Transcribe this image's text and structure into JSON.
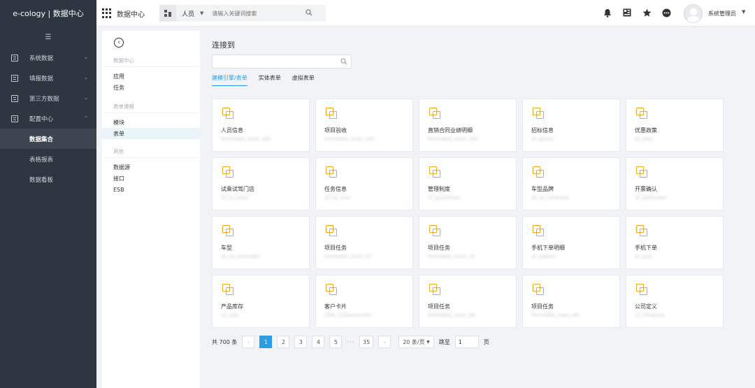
{
  "header": {
    "brand": "e-cology | 数据中心",
    "app_title": "数据中心",
    "search_scope": "人员",
    "search_placeholder": "请输入关键词搜索",
    "user_name": "系统管理员"
  },
  "sidebar": {
    "items": [
      {
        "label": "系统数据"
      },
      {
        "label": "填报数据"
      },
      {
        "label": "第三方数据"
      },
      {
        "label": "配置中心"
      }
    ],
    "sub_items": [
      {
        "label": "数据集合"
      },
      {
        "label": "表格报表"
      },
      {
        "label": "数据看板"
      }
    ]
  },
  "panel2": {
    "groups": [
      {
        "title": "数据中心",
        "items": [
          "应用",
          "任务"
        ]
      },
      {
        "title": "表单建模",
        "items": [
          "模块",
          "表单"
        ]
      },
      {
        "title": "其他",
        "items": [
          "数据源",
          "接口",
          "ESB"
        ]
      }
    ]
  },
  "main": {
    "title": "连接到",
    "tabs": [
      "建模引擎/表单",
      "实体表单",
      "虚拟表单"
    ],
    "cards": [
      {
        "name": "人员信息",
        "sub": "formtable_main_181"
      },
      {
        "name": "项目验收",
        "sub": "formtable_main_190"
      },
      {
        "name": "直销合同业绩明细",
        "sub": "formtable_main_181"
      },
      {
        "name": "招标信息",
        "sub": "uf_zpinfo"
      },
      {
        "name": "优惠政策",
        "sub": "uf_yhzc"
      },
      {
        "name": "试乘试驾门店",
        "sub": "uf_cs_store"
      },
      {
        "name": "任务信息",
        "sub": "uf_rw_xxxi"
      },
      {
        "name": "管理制度",
        "sub": "uf_gualizhidu"
      },
      {
        "name": "车型品牌",
        "sub": "ef_cd_carbrand"
      },
      {
        "name": "开票确认",
        "sub": "uf_qsenorder"
      },
      {
        "name": "车型",
        "sub": "uf_cd_carmodel"
      },
      {
        "name": "项目任务",
        "sub": "formtable_main_47"
      },
      {
        "name": "项目任务",
        "sub": "formtable_main_33"
      },
      {
        "name": "手机下单明细",
        "sub": "uf_sjxdmx"
      },
      {
        "name": "手机下单",
        "sub": "uf_sjxd"
      },
      {
        "name": "产品库存",
        "sub": "uf_cpkc"
      },
      {
        "name": "客户卡片",
        "sub": "CRM_CustomerInfo"
      },
      {
        "name": "项目任务",
        "sub": "formtable_main_56"
      },
      {
        "name": "项目任务",
        "sub": "formtable_main_69"
      },
      {
        "name": "公司定义",
        "sub": "uf_company"
      }
    ],
    "pagination": {
      "total": "共 700 条",
      "pages": [
        "1",
        "2",
        "3",
        "4",
        "5"
      ],
      "dots": "···",
      "last": "35",
      "prev": "‹",
      "next": "›",
      "page_size": "20 条/页",
      "jump_label": "跳至",
      "jump_value": "1",
      "page_unit": "页"
    }
  }
}
